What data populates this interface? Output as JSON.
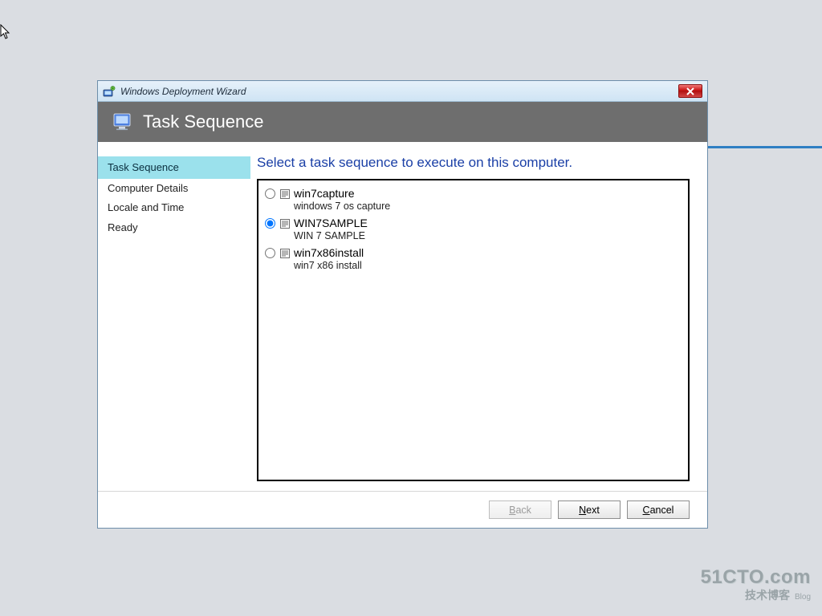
{
  "window": {
    "title": "Windows Deployment Wizard",
    "banner_title": "Task Sequence"
  },
  "sidebar": {
    "items": [
      {
        "label": "Task Sequence",
        "active": true
      },
      {
        "label": "Computer Details",
        "active": false
      },
      {
        "label": "Locale and Time",
        "active": false
      },
      {
        "label": "Ready",
        "active": false
      }
    ]
  },
  "main": {
    "instruction": "Select a task sequence to execute on this computer.",
    "task_sequences": [
      {
        "name": "win7capture",
        "desc": "windows 7 os capture",
        "selected": false
      },
      {
        "name": "WIN7SAMPLE",
        "desc": "WIN 7 SAMPLE",
        "selected": true
      },
      {
        "name": "win7x86install",
        "desc": "win7 x86 install",
        "selected": false
      }
    ]
  },
  "footer": {
    "back": {
      "label_pre": "",
      "mn": "B",
      "label_post": "ack",
      "enabled": false
    },
    "next": {
      "label_pre": "",
      "mn": "N",
      "label_post": "ext",
      "enabled": true
    },
    "cancel": {
      "label_pre": "",
      "mn": "C",
      "label_post": "ancel",
      "enabled": true
    }
  },
  "watermark": {
    "line1": "51CTO.com",
    "line2": "技术博客",
    "line3": "Blog"
  }
}
